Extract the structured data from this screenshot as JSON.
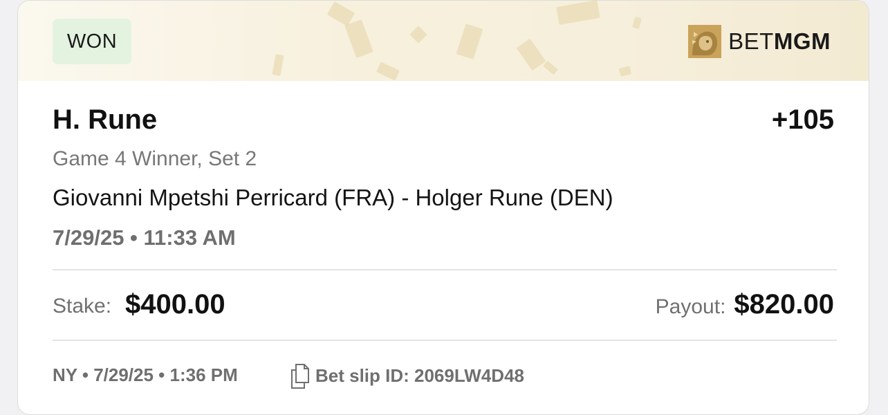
{
  "header": {
    "status": "WON",
    "brand_light": "BET",
    "brand_bold": "MGM",
    "brand_icon": "lion-logo-icon"
  },
  "bet": {
    "selection": "H. Rune",
    "odds": "+105",
    "market": "Game 4 Winner, Set 2",
    "event": "Giovanni Mpetshi Perricard (FRA) - Holger Rune (DEN)",
    "event_time": "7/29/25 • 11:33 AM"
  },
  "amounts": {
    "stake_label": "Stake:",
    "stake_value": "$400.00",
    "payout_label": "Payout:",
    "payout_value": "$820.00"
  },
  "footer": {
    "meta": "NY • 7/29/25 • 1:36 PM",
    "slip_id": "Bet slip ID: 2069LW4D48",
    "slip_icon": "copy-document-icon"
  },
  "colors": {
    "won_badge_bg": "#e4f3e0",
    "header_gold": "#f6efdc",
    "brand_gold": "#c9a35a"
  }
}
